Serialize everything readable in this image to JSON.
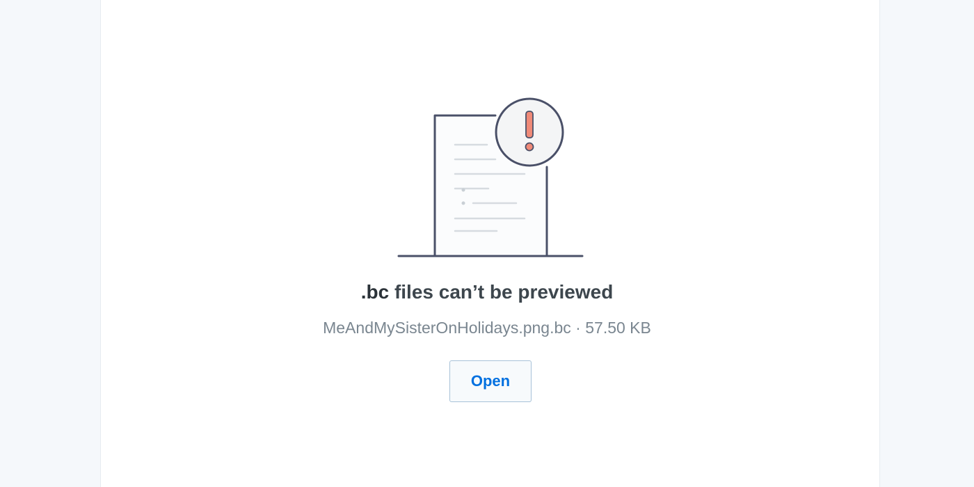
{
  "preview": {
    "extension": ".bc",
    "message": " files can’t be previewed",
    "file_name": "MeAndMySisterOnHolidays.png.bc",
    "separator": " · ",
    "file_size": "57.50 KB",
    "open_label": "Open"
  },
  "colors": {
    "page_background": "#f5f8fb",
    "panel_background": "#ffffff",
    "title_text": "#3d464d",
    "meta_text": "#7a8690",
    "button_text": "#0070e0",
    "button_border": "#a8c2d8",
    "illustration_stroke": "#4a5068",
    "alert_mark": "#f08a78"
  },
  "icons": {
    "illustration": "document-warning-icon"
  }
}
